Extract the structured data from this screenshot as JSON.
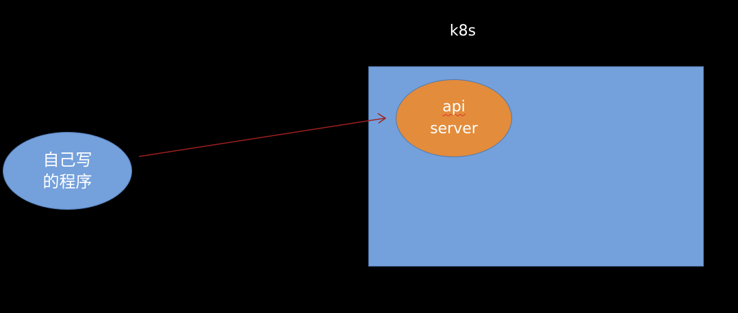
{
  "diagram": {
    "cluster": {
      "label": "k8s",
      "fill_color": "#74a0db"
    },
    "api_server": {
      "line1": "api",
      "line2": "server",
      "fill_color": "#e38c3b"
    },
    "program": {
      "line1": "自己写",
      "line2": "的程序",
      "fill_color": "#74a0db"
    },
    "arrow": {
      "from": "program",
      "to": "api_server",
      "color": "#a02020"
    }
  }
}
